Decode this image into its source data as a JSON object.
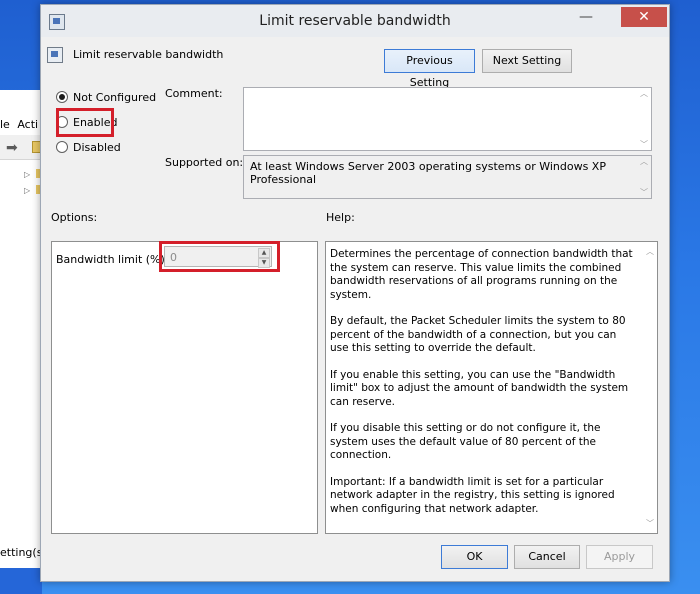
{
  "background": {
    "menu_items": [
      "le",
      "Acti"
    ],
    "status_text": "etting(s)"
  },
  "dialog": {
    "window_title": "Limit reservable bandwidth",
    "setting_name": "Limit reservable bandwidth",
    "buttons": {
      "previous": "Previous Setting",
      "next": "Next Setting",
      "ok": "OK",
      "cancel": "Cancel",
      "apply": "Apply"
    },
    "state_options": [
      {
        "label": "Not Configured",
        "checked": true
      },
      {
        "label": "Enabled",
        "checked": false
      },
      {
        "label": "Disabled",
        "checked": false
      }
    ],
    "comment": {
      "label": "Comment:",
      "value": ""
    },
    "supported_on": {
      "label": "Supported on:",
      "value": "At least Windows Server 2003 operating systems or Windows XP Professional"
    },
    "options": {
      "label": "Options:",
      "bandwidth_label": "Bandwidth limit (%):",
      "bandwidth_value": "0"
    },
    "help": {
      "label": "Help:",
      "paragraphs": [
        "Determines the percentage of connection bandwidth that the system can reserve. This value limits the combined bandwidth reservations of all programs running on the system.",
        "By default, the Packet Scheduler limits the system to 80 percent of the bandwidth of a connection, but you can use this setting to override the default.",
        "If you enable this setting, you can use the \"Bandwidth limit\" box to adjust the amount of bandwidth the system can reserve.",
        "If you disable this setting or do not configure it, the system uses the default value of 80 percent of the connection.",
        "Important: If a bandwidth limit is set for a particular network adapter in the registry, this setting is ignored when configuring that network adapter."
      ]
    },
    "colors": {
      "highlight": "#d41f2a",
      "close_button": "#c7504a",
      "dialog_background": "#f0f0f0"
    }
  }
}
